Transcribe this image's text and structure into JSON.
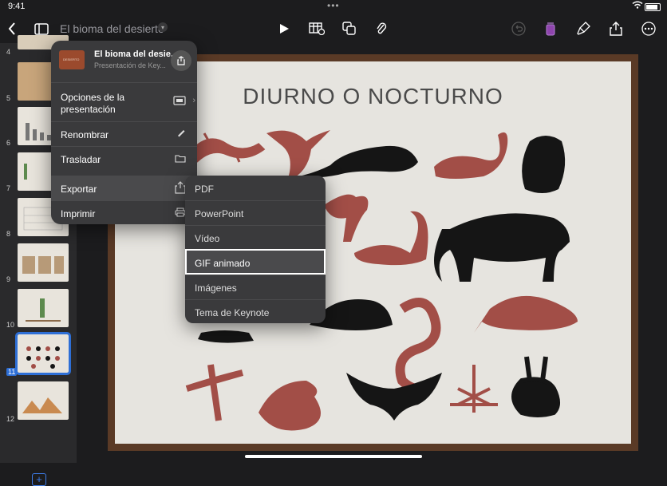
{
  "status": {
    "time": "9:41",
    "dots": "•••"
  },
  "toolbar": {
    "doc_title": "El bioma del desierto"
  },
  "sidebar": {
    "slide_numbers": [
      "4",
      "5",
      "6",
      "7",
      "8",
      "9",
      "10",
      "11",
      "12"
    ],
    "selected_slide": "11"
  },
  "slide": {
    "title": "DIURNO O NOCTURNO"
  },
  "popover": {
    "doc_name": "El bioma del desie...",
    "doc_kind": "Presentación de Key...",
    "thumb_label": "DESIERTO",
    "items": [
      {
        "label": "Opciones de la presentación"
      },
      {
        "label": "Renombrar"
      },
      {
        "label": "Trasladar"
      },
      {
        "label": "Exportar"
      },
      {
        "label": "Imprimir"
      }
    ]
  },
  "export_menu": {
    "items": [
      "PDF",
      "PowerPoint",
      "Vídeo",
      "GIF animado",
      "Imágenes",
      "Tema de Keynote"
    ],
    "selected": "GIF animado"
  },
  "colors": {
    "accent": "#2e6fd6",
    "slide_frame": "#5a3a26",
    "animal_red": "#a24e47",
    "animal_black": "#151515"
  }
}
